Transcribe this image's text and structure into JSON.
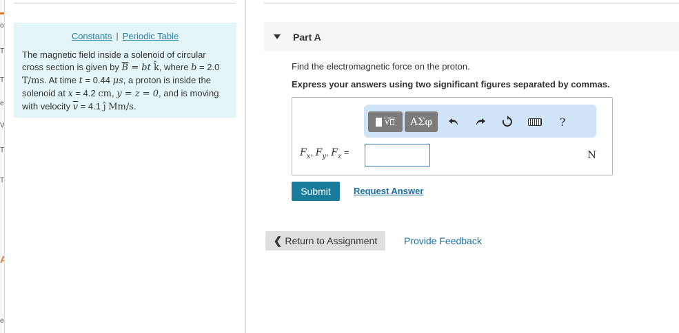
{
  "sidebar_strip": {
    "marks": [
      "o",
      "T",
      "T",
      "e",
      "V",
      "T",
      "T",
      "A",
      "e"
    ]
  },
  "problem": {
    "links": {
      "constants": "Constants",
      "separator": "|",
      "periodic_table": "Periodic Table"
    },
    "text": {
      "p1": "The magnetic field inside a solenoid of circular cross section is given by",
      "B_vec": "B",
      "eq1": " = bt ",
      "k_hat": "k̂",
      "p2": ", where",
      "b_sym": "b",
      "b_val": " = 2.0",
      "b_unit": "T/ms",
      "p3": ". At time",
      "t_sym": "t",
      "t_val": " = 0.44",
      "t_unit": "μs",
      "p4": ", a proton is inside the solenoid at",
      "x_sym": "x",
      "x_val": " = 4.2",
      "x_unit": "cm",
      "p5": ",",
      "yz": "y = z = 0",
      "p6": ", and is moving with velocity",
      "v_sym": "v",
      "v_val": " = 4.1",
      "j_hat": "ĵ",
      "v_unit": "Mm/s",
      "end": "."
    }
  },
  "part": {
    "title": "Part A"
  },
  "question": "Find the electromagnetic force on the proton.",
  "instruction": "Express your answers using two significant figures separated by commas.",
  "toolbar": {
    "greek_label": "ΑΣφ",
    "undo_icon": "undo-icon",
    "redo_icon": "redo-icon",
    "reset_icon": "reset-icon",
    "keyboard_icon": "keyboard-icon",
    "help_label": "?"
  },
  "answer": {
    "label_fx": "F",
    "sub_x": "x",
    "label_fy": "F",
    "sub_y": "y",
    "label_fz": "F",
    "sub_z": "z",
    "equals": " =",
    "value": "",
    "unit": "N"
  },
  "buttons": {
    "submit": "Submit",
    "request_answer": "Request Answer",
    "return_to_assignment": "Return to Assignment",
    "provide_feedback": "Provide Feedback"
  },
  "colors": {
    "panel_bg": "#e3f5f7",
    "link": "#2a7fa5",
    "submit_bg": "#1a7c9b",
    "toolbar_bg": "#cfe4f7"
  }
}
